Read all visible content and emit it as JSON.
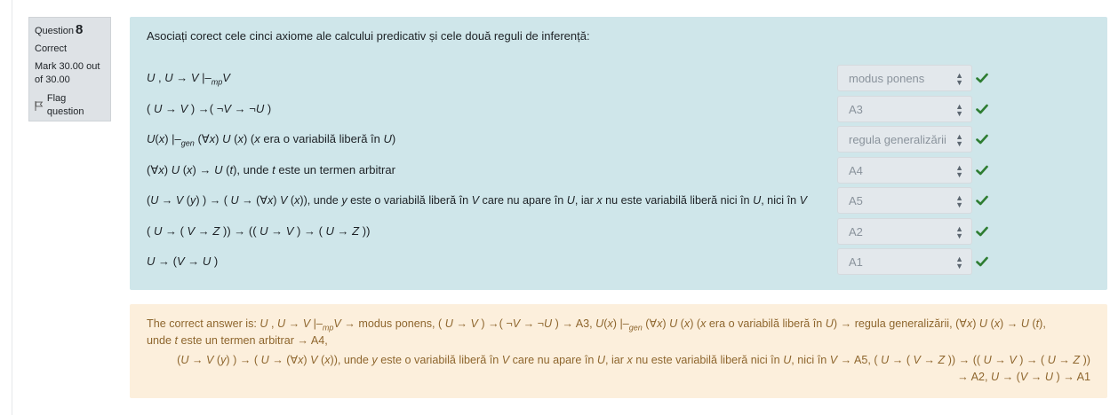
{
  "question": {
    "label": "Question",
    "number": "8",
    "state": "Correct",
    "mark_line1": "Mark 30.00 out",
    "mark_line2": "of 30.00",
    "flag_label": "Flag question"
  },
  "prompt": "Asociați corect cele cinci axiome ale calcului predicativ și cele două reguli de inferență:",
  "answers": [
    "modus ponens",
    "A3",
    "regula generalizării",
    "A4",
    "A5",
    "A2",
    "A1"
  ],
  "feedback": {
    "intro": "The correct answer is:"
  },
  "colors": {
    "formulation_bg": "#cfe6ea",
    "feedback_bg": "#fcefdc",
    "feedback_text": "#8e662e",
    "tick": "#2e7d32"
  }
}
